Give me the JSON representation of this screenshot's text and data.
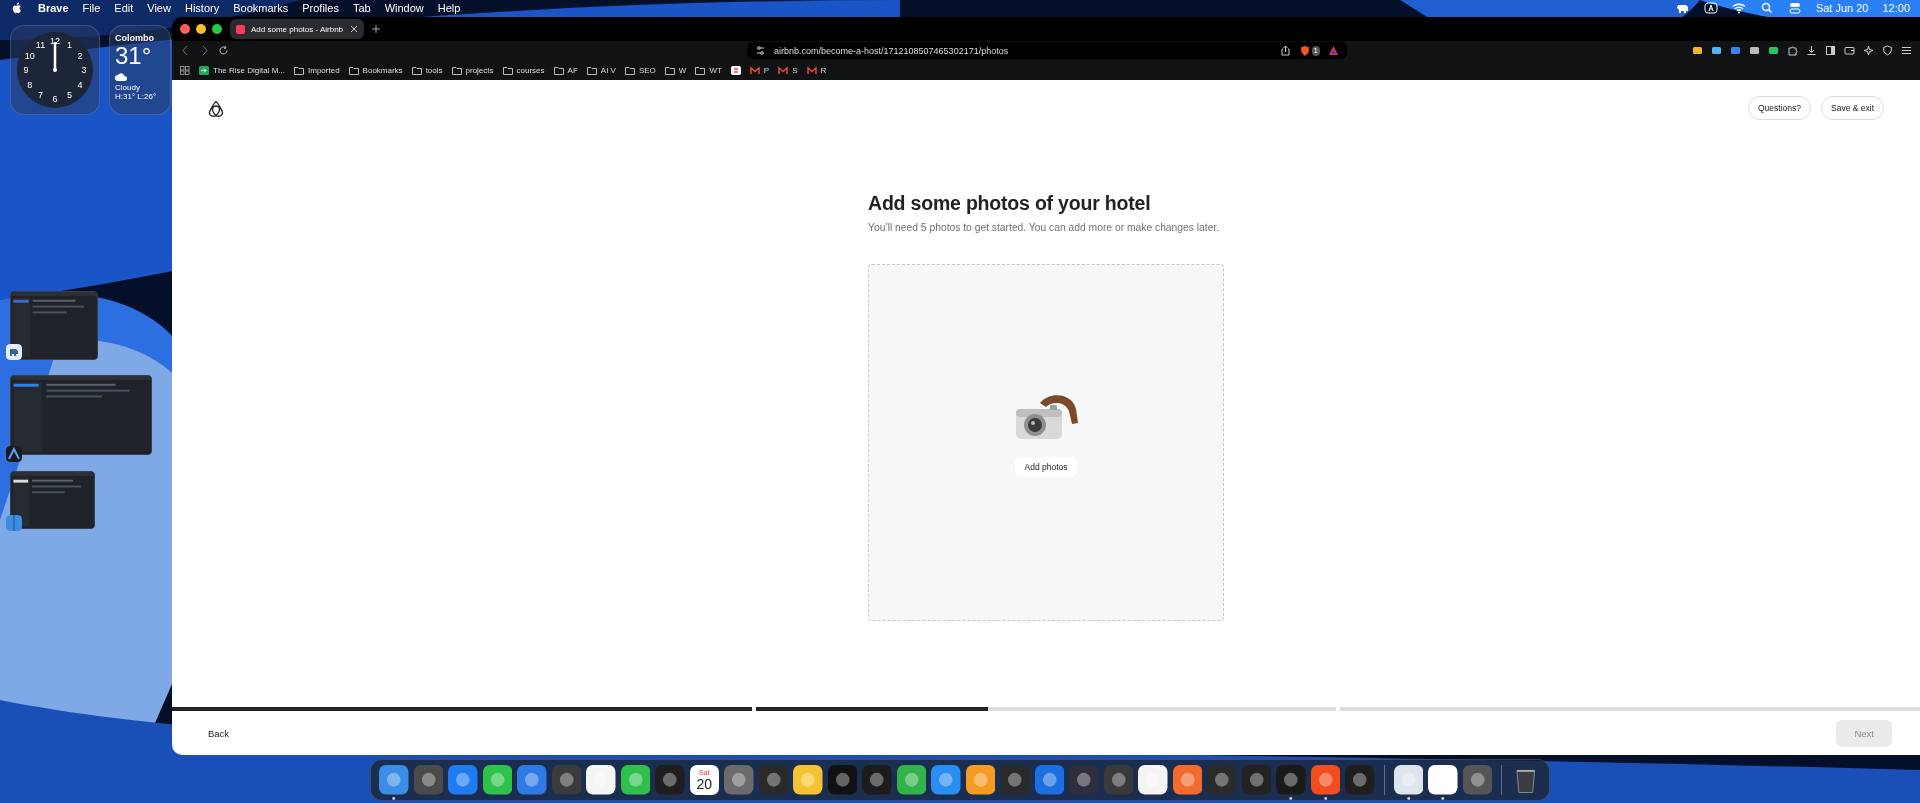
{
  "menu_bar": {
    "app": "Brave",
    "items": [
      "File",
      "Edit",
      "View",
      "History",
      "Bookmarks",
      "Profiles",
      "Tab",
      "Window",
      "Help"
    ],
    "date": "Sat Jun 20",
    "time": "12:00"
  },
  "clock_widget": {
    "numerals": [
      "12",
      "11",
      "1",
      "10",
      "2",
      "9",
      "3",
      "8",
      "4",
      "7",
      "5",
      "6"
    ]
  },
  "weather_widget": {
    "city": "Colombo",
    "temperature": "31°",
    "condition": "Cloudy",
    "range": "H:31° L:26°"
  },
  "browser": {
    "tabs": [
      {
        "title": "Add some photos - Airbnb",
        "selected": true
      }
    ],
    "url": "airbnb.com/become-a-host/1712108507465302171/photos",
    "shield_badge": "1",
    "bookmarks": [
      {
        "kind": "app",
        "label": "The Rise Digital M..."
      },
      {
        "kind": "folder",
        "label": "Imported"
      },
      {
        "kind": "folder",
        "label": "Bookmarks"
      },
      {
        "kind": "folder",
        "label": "tools"
      },
      {
        "kind": "folder",
        "label": "projects"
      },
      {
        "kind": "folder",
        "label": "courses"
      },
      {
        "kind": "folder",
        "label": "AF"
      },
      {
        "kind": "folder",
        "label": "AI V"
      },
      {
        "kind": "folder",
        "label": "SEO"
      },
      {
        "kind": "folder",
        "label": "W"
      },
      {
        "kind": "folder",
        "label": "WT"
      },
      {
        "kind": "site"
      },
      {
        "kind": "mail",
        "label": "P"
      },
      {
        "kind": "mail",
        "label": "S"
      },
      {
        "kind": "mail",
        "label": "R"
      }
    ]
  },
  "page": {
    "header_buttons": [
      "Questions?",
      "Save & exit"
    ],
    "title": "Add some photos of your hotel",
    "subtitle": "You’ll need 5 photos to get started. You can add more or make changes later.",
    "upload_button": "Add photos",
    "progress": [
      {
        "level": 1
      },
      {
        "level": 0.4
      },
      {
        "level": 0
      }
    ],
    "back": "Back",
    "next": {
      "label": "Next",
      "disabled": true
    }
  },
  "dock": {
    "groups": [
      [
        {
          "kind": "app",
          "color": "#3a8ee6",
          "running": true
        },
        {
          "kind": "app",
          "color": "#4a4a4a",
          "running": false
        },
        {
          "kind": "app",
          "color": "#1e7cf0",
          "running": false
        },
        {
          "kind": "app",
          "color": "#2fc24a",
          "running": false
        },
        {
          "kind": "app",
          "color": "#2f7ae5",
          "running": false
        },
        {
          "kind": "app",
          "color": "#3b3b3b",
          "running": false
        },
        {
          "kind": "app",
          "color": "#f5f5f5",
          "running": false
        },
        {
          "kind": "app",
          "color": "#2ec04a",
          "running": false
        },
        {
          "kind": "app",
          "color": "#1e1e1e",
          "running": false
        },
        {
          "kind": "calendar",
          "day": "Sat",
          "date": "20",
          "running": false
        },
        {
          "kind": "app",
          "color": "#6b6b6b",
          "running": false
        },
        {
          "kind": "app",
          "color": "#2a2a2a",
          "running": false
        },
        {
          "kind": "app",
          "color": "#f4c430",
          "running": false
        },
        {
          "kind": "app",
          "color": "#111111",
          "running": false
        },
        {
          "kind": "app",
          "color": "#1c1c1c",
          "running": false
        },
        {
          "kind": "app",
          "color": "#30b34a",
          "running": false
        },
        {
          "kind": "app",
          "color": "#2a8df0",
          "running": false
        },
        {
          "kind": "app",
          "color": "#f59b22",
          "running": false
        },
        {
          "kind": "app",
          "color": "#2a2a2a",
          "running": false
        },
        {
          "kind": "app",
          "color": "#1c6fe0",
          "running": false
        },
        {
          "kind": "app",
          "color": "#2e2e3e",
          "running": false
        },
        {
          "kind": "app",
          "color": "#3a3a3a",
          "running": false
        },
        {
          "kind": "app",
          "color": "#f4f4f4",
          "running": false
        },
        {
          "kind": "app",
          "color": "#f26a2c",
          "running": false
        },
        {
          "kind": "app",
          "color": "#2b2b2b",
          "running": false
        },
        {
          "kind": "app",
          "color": "#222222",
          "running": false
        },
        {
          "kind": "app",
          "color": "#1a1a1a",
          "running": true
        },
        {
          "kind": "app",
          "color": "#f24d1c",
          "running": true
        },
        {
          "kind": "app",
          "color": "#1e1e1e",
          "running": false
        }
      ],
      [
        {
          "kind": "app",
          "color": "#dde6f0",
          "running": true
        },
        {
          "kind": "app",
          "color": "#ffffff",
          "running": true
        },
        {
          "kind": "app",
          "color": "#555555",
          "running": false
        }
      ],
      [
        {
          "kind": "trash",
          "running": false
        }
      ]
    ]
  }
}
